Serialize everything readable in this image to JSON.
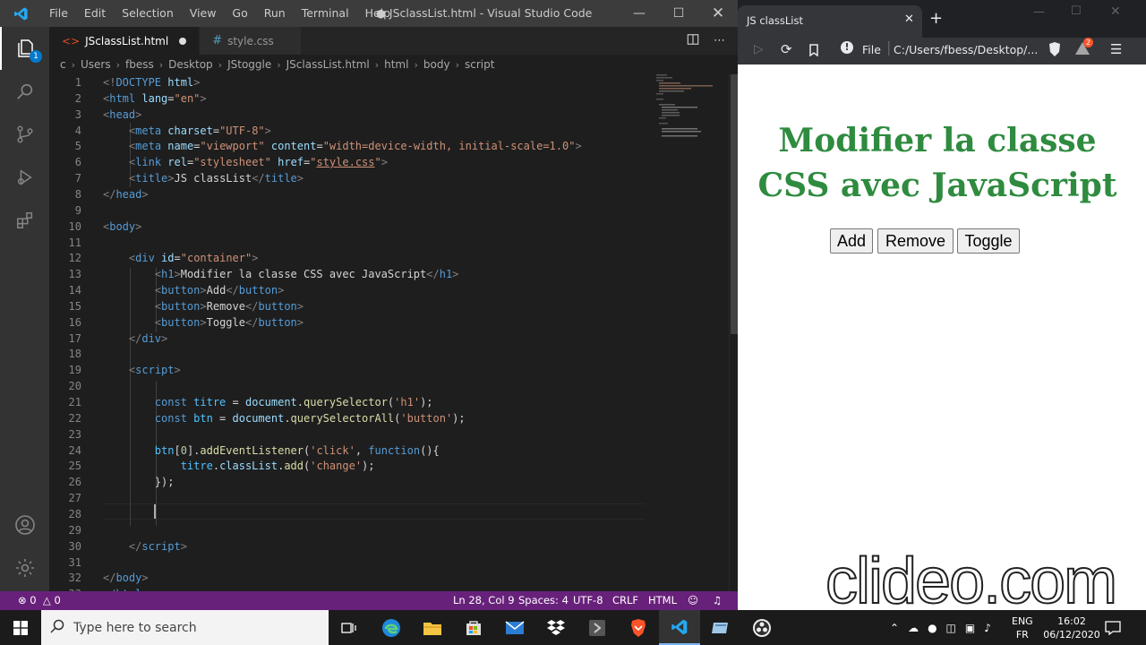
{
  "vscode": {
    "menu": [
      "File",
      "Edit",
      "Selection",
      "View",
      "Go",
      "Run",
      "Terminal",
      "Help"
    ],
    "window_title": "● JSclassList.html - Visual Studio Code",
    "tabs": [
      {
        "label": "JSclassList.html",
        "modified": true,
        "active": true
      },
      {
        "label": "style.css",
        "modified": false,
        "active": false
      }
    ],
    "breadcrumb": [
      "Users",
      "fbess",
      "Desktop",
      "JStoggle",
      "JSclassList.html",
      "html",
      "body",
      "script"
    ],
    "breadcrumb_prefix": "c",
    "code_lines": [
      {
        "n": "1",
        "tokens": [
          [
            "tag",
            "<!"
          ],
          [
            "name",
            "DOCTYPE"
          ],
          [
            "attr",
            " html"
          ],
          [
            "tag",
            ">"
          ]
        ]
      },
      {
        "n": "2",
        "tokens": [
          [
            "tag",
            "<"
          ],
          [
            "name",
            "html"
          ],
          [
            "attr",
            " lang"
          ],
          [
            "text",
            "="
          ],
          [
            "str",
            "\"en\""
          ],
          [
            "tag",
            ">"
          ]
        ]
      },
      {
        "n": "3",
        "tokens": [
          [
            "tag",
            "<"
          ],
          [
            "name",
            "head"
          ],
          [
            "tag",
            ">"
          ]
        ]
      },
      {
        "n": "4",
        "tokens": [
          [
            "text",
            "    "
          ],
          [
            "tag",
            "<"
          ],
          [
            "name",
            "meta"
          ],
          [
            "attr",
            " charset"
          ],
          [
            "text",
            "="
          ],
          [
            "str",
            "\"UTF-8\""
          ],
          [
            "tag",
            ">"
          ]
        ]
      },
      {
        "n": "5",
        "tokens": [
          [
            "text",
            "    "
          ],
          [
            "tag",
            "<"
          ],
          [
            "name",
            "meta"
          ],
          [
            "attr",
            " name"
          ],
          [
            "text",
            "="
          ],
          [
            "str",
            "\"viewport\""
          ],
          [
            "attr",
            " content"
          ],
          [
            "text",
            "="
          ],
          [
            "str",
            "\"width=device-width, initial-scale=1.0\""
          ],
          [
            "tag",
            ">"
          ]
        ]
      },
      {
        "n": "6",
        "tokens": [
          [
            "text",
            "    "
          ],
          [
            "tag",
            "<"
          ],
          [
            "name",
            "link"
          ],
          [
            "attr",
            " rel"
          ],
          [
            "text",
            "="
          ],
          [
            "str",
            "\"stylesheet\""
          ],
          [
            "attr",
            " href"
          ],
          [
            "text",
            "="
          ],
          [
            "str",
            "\""
          ],
          [
            "link",
            "style.css"
          ],
          [
            "str",
            "\""
          ],
          [
            "tag",
            ">"
          ]
        ]
      },
      {
        "n": "7",
        "tokens": [
          [
            "text",
            "    "
          ],
          [
            "tag",
            "<"
          ],
          [
            "name",
            "title"
          ],
          [
            "tag",
            ">"
          ],
          [
            "text",
            "JS classList"
          ],
          [
            "tag",
            "</"
          ],
          [
            "name",
            "title"
          ],
          [
            "tag",
            ">"
          ]
        ]
      },
      {
        "n": "8",
        "tokens": [
          [
            "tag",
            "</"
          ],
          [
            "name",
            "head"
          ],
          [
            "tag",
            ">"
          ]
        ]
      },
      {
        "n": "9",
        "tokens": []
      },
      {
        "n": "10",
        "tokens": [
          [
            "tag",
            "<"
          ],
          [
            "name",
            "body"
          ],
          [
            "tag",
            ">"
          ]
        ]
      },
      {
        "n": "11",
        "tokens": []
      },
      {
        "n": "12",
        "tokens": [
          [
            "text",
            "    "
          ],
          [
            "tag",
            "<"
          ],
          [
            "name",
            "div"
          ],
          [
            "attr",
            " id"
          ],
          [
            "text",
            "="
          ],
          [
            "str",
            "\"container\""
          ],
          [
            "tag",
            ">"
          ]
        ]
      },
      {
        "n": "13",
        "tokens": [
          [
            "text",
            "        "
          ],
          [
            "tag",
            "<"
          ],
          [
            "name",
            "h1"
          ],
          [
            "tag",
            ">"
          ],
          [
            "text",
            "Modifier la classe CSS avec JavaScript"
          ],
          [
            "tag",
            "</"
          ],
          [
            "name",
            "h1"
          ],
          [
            "tag",
            ">"
          ]
        ]
      },
      {
        "n": "14",
        "tokens": [
          [
            "text",
            "        "
          ],
          [
            "tag",
            "<"
          ],
          [
            "name",
            "button"
          ],
          [
            "tag",
            ">"
          ],
          [
            "text",
            "Add"
          ],
          [
            "tag",
            "</"
          ],
          [
            "name",
            "button"
          ],
          [
            "tag",
            ">"
          ]
        ]
      },
      {
        "n": "15",
        "tokens": [
          [
            "text",
            "        "
          ],
          [
            "tag",
            "<"
          ],
          [
            "name",
            "button"
          ],
          [
            "tag",
            ">"
          ],
          [
            "text",
            "Remove"
          ],
          [
            "tag",
            "</"
          ],
          [
            "name",
            "button"
          ],
          [
            "tag",
            ">"
          ]
        ]
      },
      {
        "n": "16",
        "tokens": [
          [
            "text",
            "        "
          ],
          [
            "tag",
            "<"
          ],
          [
            "name",
            "button"
          ],
          [
            "tag",
            ">"
          ],
          [
            "text",
            "Toggle"
          ],
          [
            "tag",
            "</"
          ],
          [
            "name",
            "button"
          ],
          [
            "tag",
            ">"
          ]
        ]
      },
      {
        "n": "17",
        "tokens": [
          [
            "text",
            "    "
          ],
          [
            "tag",
            "</"
          ],
          [
            "name",
            "div"
          ],
          [
            "tag",
            ">"
          ]
        ]
      },
      {
        "n": "18",
        "tokens": []
      },
      {
        "n": "19",
        "tokens": [
          [
            "text",
            "    "
          ],
          [
            "tag",
            "<"
          ],
          [
            "name",
            "script"
          ],
          [
            "tag",
            ">"
          ]
        ]
      },
      {
        "n": "20",
        "tokens": []
      },
      {
        "n": "21",
        "tokens": [
          [
            "text",
            "        "
          ],
          [
            "kw",
            "const"
          ],
          [
            "var",
            " titre"
          ],
          [
            "text",
            " = "
          ],
          [
            "prop",
            "document"
          ],
          [
            "text",
            "."
          ],
          [
            "fn",
            "querySelector"
          ],
          [
            "text",
            "("
          ],
          [
            "str",
            "'h1'"
          ],
          [
            "text",
            ");"
          ]
        ]
      },
      {
        "n": "22",
        "tokens": [
          [
            "text",
            "        "
          ],
          [
            "kw",
            "const"
          ],
          [
            "var",
            " btn"
          ],
          [
            "text",
            " = "
          ],
          [
            "prop",
            "document"
          ],
          [
            "text",
            "."
          ],
          [
            "fn",
            "querySelectorAll"
          ],
          [
            "text",
            "("
          ],
          [
            "str",
            "'button'"
          ],
          [
            "text",
            ");"
          ]
        ]
      },
      {
        "n": "23",
        "tokens": []
      },
      {
        "n": "24",
        "tokens": [
          [
            "text",
            "        "
          ],
          [
            "var",
            "btn"
          ],
          [
            "text",
            "["
          ],
          [
            "num",
            "0"
          ],
          [
            "text",
            "]."
          ],
          [
            "fn",
            "addEventListener"
          ],
          [
            "text",
            "("
          ],
          [
            "str",
            "'click'"
          ],
          [
            "text",
            ", "
          ],
          [
            "kw",
            "function"
          ],
          [
            "text",
            "(){"
          ]
        ]
      },
      {
        "n": "25",
        "tokens": [
          [
            "text",
            "            "
          ],
          [
            "var",
            "titre"
          ],
          [
            "text",
            "."
          ],
          [
            "prop",
            "classList"
          ],
          [
            "text",
            "."
          ],
          [
            "fn",
            "add"
          ],
          [
            "text",
            "("
          ],
          [
            "str",
            "'change'"
          ],
          [
            "text",
            ");"
          ]
        ]
      },
      {
        "n": "26",
        "tokens": [
          [
            "text",
            "        "
          ],
          [
            "text",
            "});"
          ]
        ]
      },
      {
        "n": "27",
        "tokens": []
      },
      {
        "n": "28",
        "tokens": []
      },
      {
        "n": "29",
        "tokens": []
      },
      {
        "n": "30",
        "tokens": [
          [
            "text",
            "    "
          ],
          [
            "tag",
            "</"
          ],
          [
            "name",
            "script"
          ],
          [
            "tag",
            ">"
          ]
        ]
      },
      {
        "n": "31",
        "tokens": []
      },
      {
        "n": "32",
        "tokens": [
          [
            "tag",
            "</"
          ],
          [
            "name",
            "body"
          ],
          [
            "tag",
            ">"
          ]
        ]
      },
      {
        "n": "33",
        "tokens": [
          [
            "tag",
            "</"
          ],
          [
            "name",
            "html"
          ],
          [
            "tag",
            ">"
          ]
        ]
      }
    ],
    "status": {
      "errors": "0",
      "warnings": "0",
      "position": "Ln 28, Col 9",
      "spaces": "Spaces: 4",
      "encoding": "UTF-8",
      "eol": "CRLF",
      "language": "HTML"
    },
    "colors": {
      "statusbar": "#68217a",
      "accent": "#007acc"
    }
  },
  "browser": {
    "tab_title": "JS classList",
    "address_label": "File",
    "address": "C:/Users/fbess/Desktop/...",
    "badge_count": "2",
    "page": {
      "heading": "Modifier la classe CSS avec JavaScript",
      "buttons": [
        "Add",
        "Remove",
        "Toggle"
      ],
      "heading_color": "#2e8b3f"
    }
  },
  "watermark": "clideo.com",
  "taskbar": {
    "search_placeholder": "Type here to search",
    "lang_top": "ENG",
    "lang_bottom": "FR",
    "time": "16:02",
    "date": "06/12/2020"
  }
}
